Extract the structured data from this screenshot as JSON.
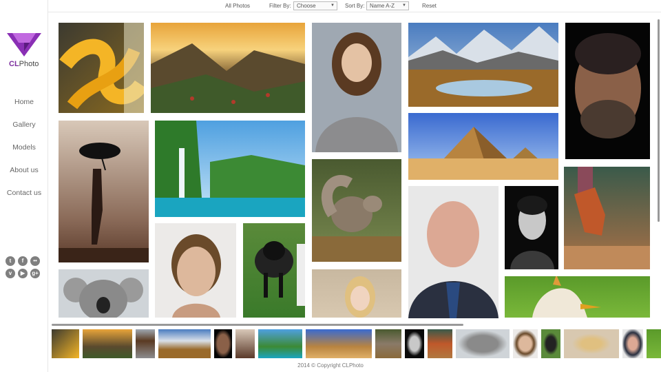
{
  "brand": {
    "cl": "CL",
    "photo": "Photo"
  },
  "nav": [
    "Home",
    "Gallery",
    "Models",
    "About us",
    "Contact us"
  ],
  "social": [
    {
      "icon": "twitter-icon",
      "glyph": "t"
    },
    {
      "icon": "facebook-icon",
      "glyph": "f"
    },
    {
      "icon": "flickr-icon",
      "glyph": "••"
    },
    {
      "icon": "vimeo-icon",
      "glyph": "v"
    },
    {
      "icon": "youtube-icon",
      "glyph": "▶"
    },
    {
      "icon": "googleplus-icon",
      "glyph": "g+"
    }
  ],
  "toolbar": {
    "all_photos": "All Photos",
    "filter_label": "Filter By:",
    "filter_value": "Choose",
    "sort_label": "Sort By:",
    "sort_value": "Name A-Z",
    "reset": "Reset"
  },
  "photos": [
    {
      "name": "photo-rope"
    },
    {
      "name": "photo-mountain-sunset"
    },
    {
      "name": "photo-woman-portrait"
    },
    {
      "name": "photo-mountain-lake"
    },
    {
      "name": "photo-man-face"
    },
    {
      "name": "photo-umbrella-girl"
    },
    {
      "name": "photo-waterfall"
    },
    {
      "name": "photo-squirrel"
    },
    {
      "name": "photo-pyramid"
    },
    {
      "name": "photo-businessman"
    },
    {
      "name": "photo-young-man"
    },
    {
      "name": "photo-shoes"
    },
    {
      "name": "photo-koala"
    },
    {
      "name": "photo-short-hair-woman"
    },
    {
      "name": "photo-sheep"
    },
    {
      "name": "photo-blonde-girl"
    },
    {
      "name": "photo-bird"
    }
  ],
  "footer": "2014 © Copyright CLPhoto",
  "colors": {
    "brand": "#7b2c9e",
    "logo_light": "#b05bd0"
  }
}
